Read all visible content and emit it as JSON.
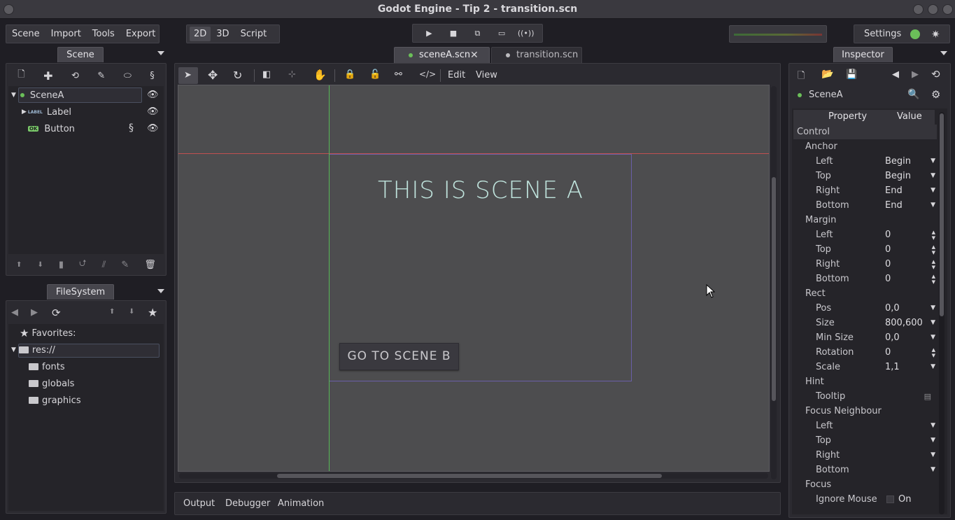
{
  "window": {
    "title": "Godot Engine - Tip 2 - transition.scn"
  },
  "menu": {
    "items": [
      "Scene",
      "Import",
      "Tools",
      "Export"
    ]
  },
  "modes": {
    "items": [
      "2D",
      "3D",
      "Script"
    ],
    "active": "2D"
  },
  "top_right": {
    "settings_label": "Settings"
  },
  "scene_dock": {
    "tab_label": "Scene",
    "tree": [
      {
        "name": "SceneA",
        "type": "Control"
      },
      {
        "name": "Label",
        "type": "Label"
      },
      {
        "name": "Button",
        "type": "Button"
      }
    ],
    "label_badge": "LABEL",
    "button_badge": "OK"
  },
  "filesystem_dock": {
    "tab_label": "FileSystem",
    "favorites_label": "Favorites:",
    "root": "res://",
    "folders": [
      "fonts",
      "globals",
      "graphics"
    ]
  },
  "editor_tabs": [
    {
      "label": "sceneA.scn",
      "active": true
    },
    {
      "label": "transition.scn",
      "active": false
    }
  ],
  "canvas_menu": {
    "edit": "Edit",
    "view": "View"
  },
  "canvas": {
    "heading": "THIS IS SCENE A",
    "button_text": "GO TO SCENE B"
  },
  "bottom_tabs": [
    "Output",
    "Debugger",
    "Animation"
  ],
  "inspector": {
    "tab_label": "Inspector",
    "object_name": "SceneA",
    "header_property": "Property",
    "header_value": "Value",
    "rows": [
      {
        "kind": "category",
        "label": "Control"
      },
      {
        "kind": "group",
        "label": "Anchor"
      },
      {
        "kind": "prop",
        "label": "Left",
        "value": "Begin",
        "control": "dropdown"
      },
      {
        "kind": "prop",
        "label": "Top",
        "value": "Begin",
        "control": "dropdown"
      },
      {
        "kind": "prop",
        "label": "Right",
        "value": "End",
        "control": "dropdown"
      },
      {
        "kind": "prop",
        "label": "Bottom",
        "value": "End",
        "control": "dropdown"
      },
      {
        "kind": "group",
        "label": "Margin"
      },
      {
        "kind": "prop",
        "label": "Left",
        "value": "0",
        "control": "spin"
      },
      {
        "kind": "prop",
        "label": "Top",
        "value": "0",
        "control": "spin"
      },
      {
        "kind": "prop",
        "label": "Right",
        "value": "0",
        "control": "spin"
      },
      {
        "kind": "prop",
        "label": "Bottom",
        "value": "0",
        "control": "spin"
      },
      {
        "kind": "group",
        "label": "Rect"
      },
      {
        "kind": "prop",
        "label": "Pos",
        "value": "0,0",
        "control": "dropdown"
      },
      {
        "kind": "prop",
        "label": "Size",
        "value": "800,600",
        "control": "dropdown"
      },
      {
        "kind": "prop",
        "label": "Min Size",
        "value": "0,0",
        "control": "dropdown"
      },
      {
        "kind": "prop",
        "label": "Rotation",
        "value": "0",
        "control": "spin"
      },
      {
        "kind": "prop",
        "label": "Scale",
        "value": "1,1",
        "control": "dropdown"
      },
      {
        "kind": "group",
        "label": "Hint"
      },
      {
        "kind": "prop",
        "label": "Tooltip",
        "value": "",
        "control": "edit"
      },
      {
        "kind": "group",
        "label": "Focus Neighbour"
      },
      {
        "kind": "prop",
        "label": "Left",
        "value": "",
        "control": "dropdown"
      },
      {
        "kind": "prop",
        "label": "Top",
        "value": "",
        "control": "dropdown"
      },
      {
        "kind": "prop",
        "label": "Right",
        "value": "",
        "control": "dropdown"
      },
      {
        "kind": "prop",
        "label": "Bottom",
        "value": "",
        "control": "dropdown"
      },
      {
        "kind": "group",
        "label": "Focus"
      },
      {
        "kind": "prop",
        "label": "Ignore Mouse",
        "value": "On",
        "control": "checkbox"
      }
    ]
  },
  "colors": {
    "canvas_bg": "#4d4d4f",
    "scene_text": "#bfe3dc",
    "guide_red": "#c05050",
    "guide_green": "#57b957",
    "rect_purple": "#6a5fa8",
    "status_ok": "#6bbf59"
  }
}
